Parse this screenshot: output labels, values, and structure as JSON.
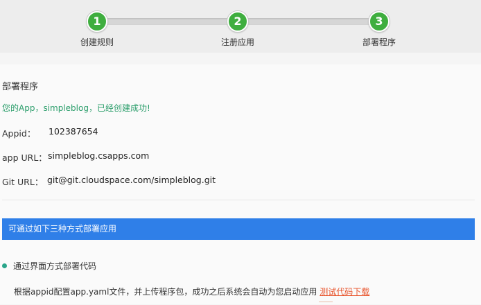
{
  "steps": [
    {
      "number": "1",
      "label": "创建规则"
    },
    {
      "number": "2",
      "label": "注册应用"
    },
    {
      "number": "3",
      "label": "部署程序"
    }
  ],
  "main": {
    "title": "部署程序",
    "success_message": "您的App，simpleblog，已经创建成功!",
    "fields": {
      "appid": {
        "label": "Appid：",
        "value": "102387654"
      },
      "app_url": {
        "label": "app URL：",
        "value": "simpleblog.csapps.com"
      },
      "git_url": {
        "label": "Git URL：",
        "value": "git@git.cloudspace.com/simpleblog.git"
      }
    },
    "banner": "可通过如下三种方式部署应用",
    "method1": {
      "title": "通过界面方式部署代码",
      "description": "根据appid配置app.yaml文件，并上传程序包，成功之后系统会自动为您启动应用",
      "link": "测试代码下载"
    }
  },
  "colors": {
    "step_green": "#3fae3f",
    "banner_blue": "#2f7fe8",
    "success_green": "#2a9d6a",
    "link_orange": "#e8542c"
  }
}
